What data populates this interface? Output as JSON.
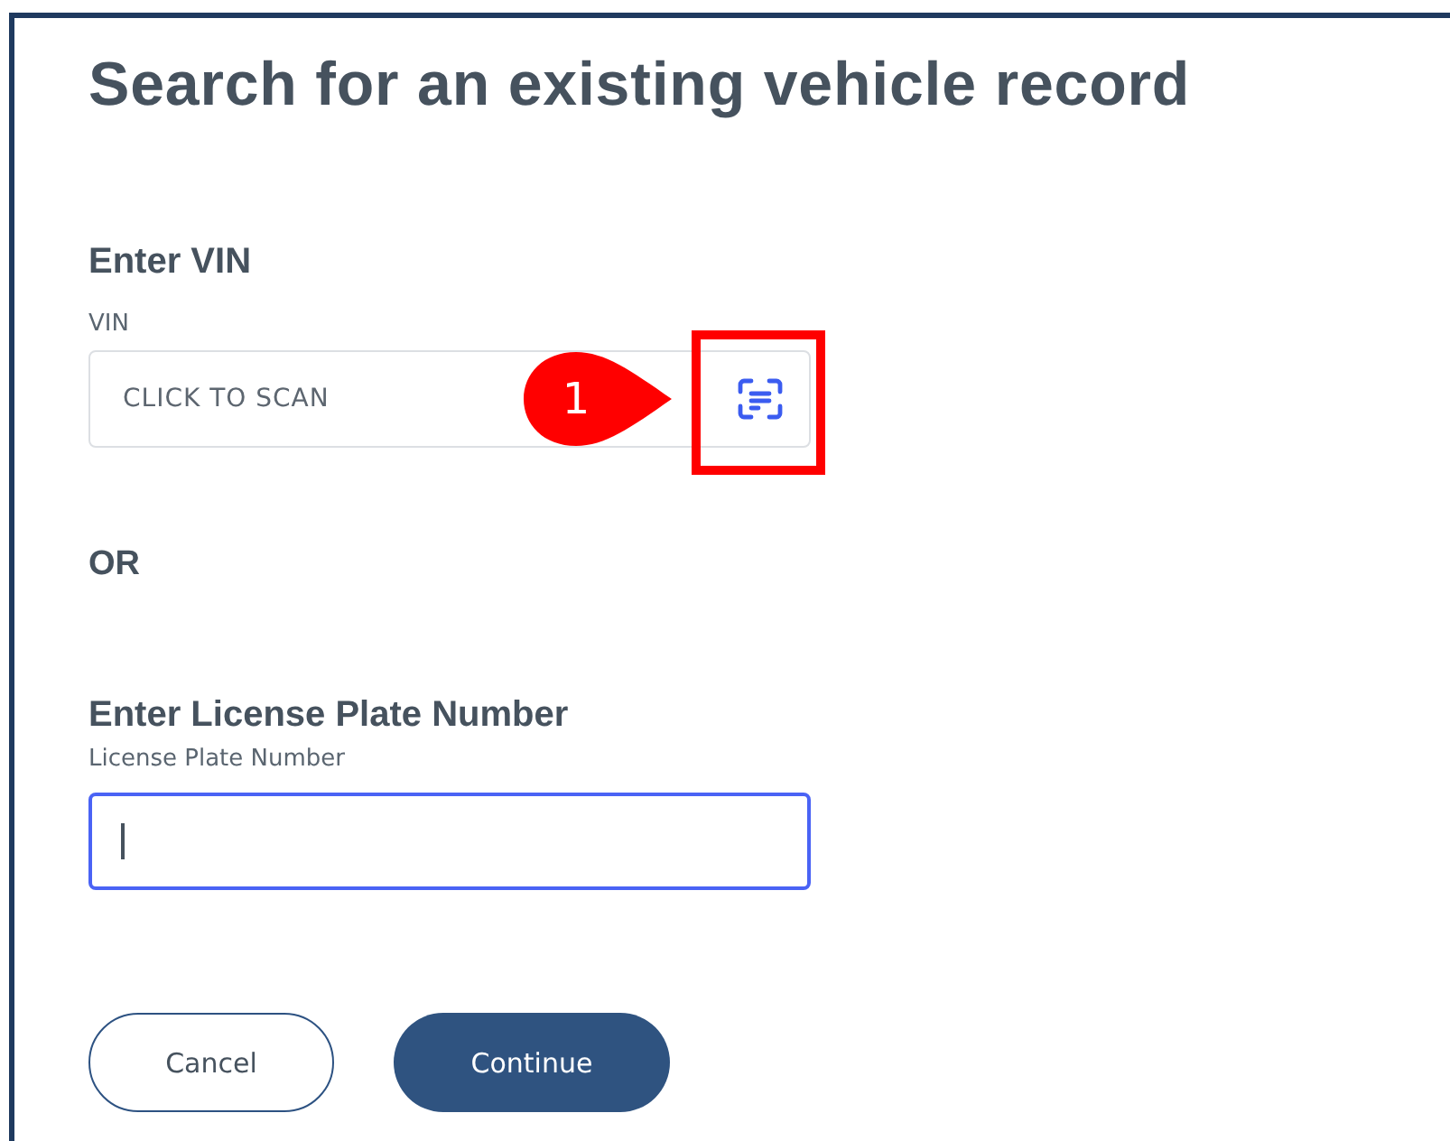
{
  "title": "Search for an existing vehicle record",
  "vin_section": {
    "heading": "Enter VIN",
    "label": "VIN",
    "placeholder": "CLICK TO SCAN",
    "callout": "1",
    "highlighted": true
  },
  "separator": "OR",
  "plate_section": {
    "heading": "Enter License Plate Number",
    "label": "License Plate Number",
    "focused": true
  },
  "buttons": [
    {
      "label": "Cancel",
      "kind": "outline"
    },
    {
      "label": "Continue",
      "kind": "filled"
    }
  ]
}
